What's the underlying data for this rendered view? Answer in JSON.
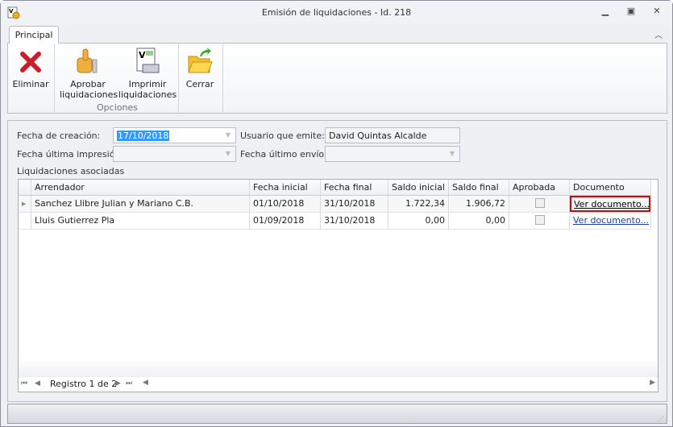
{
  "window": {
    "title": "Emisión de liquidaciones - Id. 218"
  },
  "tabs": [
    {
      "label": "Principal",
      "active": true
    }
  ],
  "ribbon": {
    "buttons": [
      {
        "label": "Eliminar",
        "icon": "delete-x-icon"
      },
      {
        "label": "Aprobar liquidaciones",
        "icon": "thumbs-up-icon"
      },
      {
        "label": "Imprimir liquidaciones",
        "icon": "print-document-icon"
      },
      {
        "label": "Cerrar",
        "icon": "folder-exit-icon"
      }
    ],
    "group_label": "Opciones"
  },
  "form": {
    "fecha_creacion_label": "Fecha de creación:",
    "fecha_creacion_value": "17/10/2018",
    "usuario_label": "Usuario que emite:",
    "usuario_value": "David Quintas Alcalde",
    "fecha_impresion_label": "Fecha última impresión:",
    "fecha_impresion_value": "",
    "fecha_envio_label": "Fecha último envío:",
    "fecha_envio_value": "",
    "grid_label": "Liquidaciones asociadas"
  },
  "grid": {
    "columns": [
      "Arrendador",
      "Fecha inicial",
      "Fecha final",
      "Saldo inicial",
      "Saldo final",
      "Aprobada",
      "Documento"
    ],
    "rows": [
      {
        "arrendador": "Sanchez Llibre Julian y Mariano C.B.",
        "fecha_inicial": "01/10/2018",
        "fecha_final": "31/10/2018",
        "saldo_inicial": "1.722,34",
        "saldo_final": "1.906,72",
        "aprobada": false,
        "documento": "Ver documento..."
      },
      {
        "arrendador": "Lluis Gutierrez Pla",
        "fecha_inicial": "01/09/2018",
        "fecha_final": "31/10/2018",
        "saldo_inicial": "0,00",
        "saldo_final": "0,00",
        "aprobada": false,
        "documento": "Ver documento..."
      }
    ],
    "navigator": "Registro 1 de 2"
  },
  "colors": {
    "focus_border": "#e00000",
    "selection": "#3399ff",
    "link": "#1a3ea8"
  }
}
